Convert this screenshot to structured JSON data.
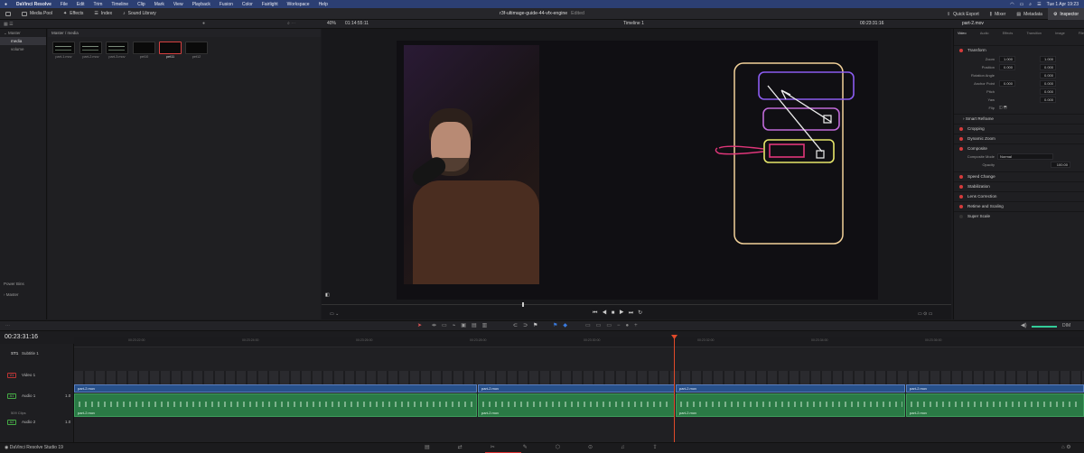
{
  "menubar": {
    "app": "DaVinci Resolve",
    "items": [
      "File",
      "Edit",
      "Trim",
      "Timeline",
      "Clip",
      "Mark",
      "View",
      "Playback",
      "Fusion",
      "Color",
      "Fairlight",
      "Workspace",
      "Help"
    ],
    "clock": "Tue 1 Apr 19:23"
  },
  "toolbar": {
    "media_pool": "Media Pool",
    "effects": "Effects",
    "index": "Index",
    "sound_library": "Sound Library",
    "project_title": "r3f-ultimage-guide-44-vfx-engine",
    "edited": "Edited",
    "quick_export": "Quick Export",
    "mixer": "Mixer",
    "metadata": "Metadata",
    "inspector": "Inspector"
  },
  "subbar": {
    "zoom": "40%",
    "source_tc": "01:14:55:11",
    "timeline_name": "Timeline 1",
    "record_tc": "00:23:31:16",
    "clip_name": "part-2.mov"
  },
  "bins": {
    "master": "Master",
    "media": "media",
    "volume": "volume",
    "power_bins": "Power Bins",
    "power_master": "Master"
  },
  "pool": {
    "path": "Master / media",
    "clips": [
      {
        "label": "part-1.mov"
      },
      {
        "label": "part-2.mov"
      },
      {
        "label": "part-3.mov"
      },
      {
        "label": "pet10"
      },
      {
        "label": "pet11"
      },
      {
        "label": "pet12"
      }
    ]
  },
  "inspector": {
    "tabs": [
      "Video",
      "Audio",
      "Effects",
      "Transition",
      "Image",
      "File"
    ],
    "transform": "Transform",
    "zoom_label": "Zoom",
    "zoom_x": "1.000",
    "zoom_y": "1.000",
    "position_label": "Position",
    "position_x": "0.000",
    "position_y": "0.000",
    "rotation_label": "Rotation Angle",
    "rotation": "0.000",
    "anchor_label": "Anchor Point",
    "anchor_x": "0.000",
    "anchor_y": "0.000",
    "pitch_label": "Pitch",
    "pitch": "0.000",
    "yaw_label": "Yaw",
    "yaw": "0.000",
    "flip_label": "Flip",
    "smart_reframe": "Smart Reframe",
    "cropping": "Cropping",
    "dynamic_zoom": "Dynamic Zoom",
    "composite": "Composite",
    "composite_mode_label": "Composite Mode",
    "composite_mode": "Normal",
    "opacity_label": "Opacity",
    "opacity": "100.00",
    "speed_change": "Speed Change",
    "stabilization": "Stabilization",
    "lens_correction": "Lens Correction",
    "retime": "Retime and Scaling",
    "super_scale": "Super Scale"
  },
  "timeline": {
    "timecode": "00:23:31:16",
    "ticks": [
      "00:23:22:00",
      "00:23:24:00",
      "00:23:26:00",
      "00:23:28:00",
      "00:23:30:00",
      "00:23:32:00",
      "00:23:34:00",
      "00:23:36:00"
    ],
    "st1": "ST1",
    "subtitle": "Subtitle 1",
    "v1": "V1",
    "video1": "Video 1",
    "a1": "A1",
    "audio1": "Audio 1",
    "a1_ch": "1.0",
    "clips_count": "509 Clips",
    "a2": "A2",
    "audio2": "Audio 2",
    "a2_ch": "1.0",
    "video_clips": [
      "part-2.mov",
      "part-2.mov",
      "part-2.mov",
      "part-2.mov"
    ],
    "audio_clips": [
      "part-2.mov",
      "part-2.mov",
      "part-2.mov",
      "part-2.mov"
    ],
    "volume_label": "DIM"
  },
  "footer": {
    "app_version": "DaVinci Resolve Studio 19"
  }
}
